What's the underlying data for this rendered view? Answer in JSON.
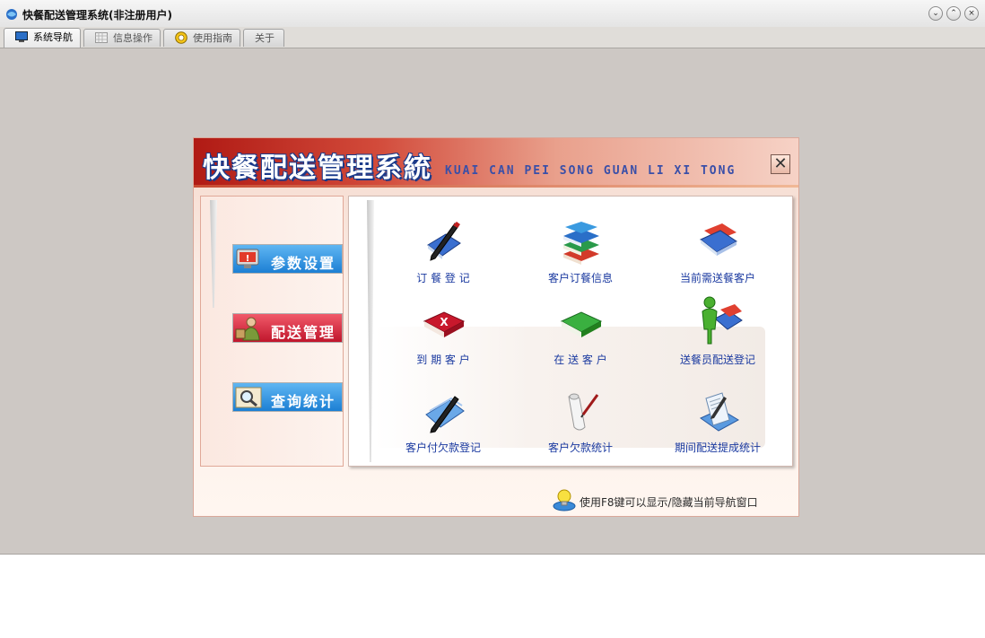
{
  "window": {
    "title": "快餐配送管理系统(非注册用户)"
  },
  "tabs": [
    {
      "label": "系统导航",
      "active": true
    },
    {
      "label": "信息操作",
      "active": false
    },
    {
      "label": "使用指南",
      "active": false
    },
    {
      "label": "关于",
      "active": false
    }
  ],
  "panel": {
    "title": "快餐配送管理系統",
    "subtitle": "KUAI CAN PEI SONG GUAN LI XI TONG",
    "close_label": "✕"
  },
  "nav": [
    {
      "label": "参数设置",
      "icon": "warning-monitor-icon",
      "color": "#1c7fd4"
    },
    {
      "label": "配送管理",
      "icon": "delivery-person-icon",
      "color": "#c0162c"
    },
    {
      "label": "查询统计",
      "icon": "magnifier-icon",
      "color": "#1c7fd4"
    }
  ],
  "grid": [
    {
      "label": "订 餐 登 记",
      "icon": "pen-notebook-icon"
    },
    {
      "label": "客户订餐信息",
      "icon": "stacked-books-icon"
    },
    {
      "label": "当前需送餐客户",
      "icon": "folders-icon"
    },
    {
      "label": "到 期 客 户",
      "icon": "red-book-x-icon"
    },
    {
      "label": "在 送 客 户",
      "icon": "green-book-icon"
    },
    {
      "label": "送餐员配送登记",
      "icon": "person-folder-icon"
    },
    {
      "label": "客户付欠款登记",
      "icon": "pen-paper-icon"
    },
    {
      "label": "客户欠款统计",
      "icon": "scroll-pen-icon"
    },
    {
      "label": "期间配送提成统计",
      "icon": "document-pen-icon"
    }
  ],
  "tip": {
    "text": "使用F8键可以显示/隐藏当前导航窗口"
  }
}
